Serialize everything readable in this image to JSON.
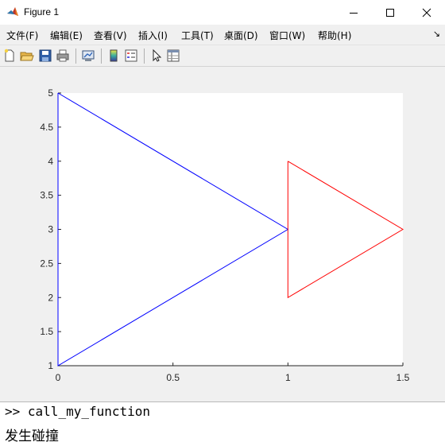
{
  "window": {
    "title": "Figure 1"
  },
  "menubar": {
    "items": [
      "文件(F)",
      "编辑(E)",
      "查看(V)",
      "插入(I)",
      "工具(T)",
      "桌面(D)",
      "窗口(W)",
      "帮助(H)"
    ]
  },
  "toolbar": {
    "icons": [
      "new-figure-icon",
      "open-file-icon",
      "save-icon",
      "print-icon",
      "link-plot-icon",
      "colorbar-icon",
      "legend-icon",
      "pointer-icon",
      "property-inspector-icon"
    ]
  },
  "chart_data": {
    "type": "line",
    "title": "",
    "xlabel": "",
    "ylabel": "",
    "xlim": [
      0,
      1.5
    ],
    "ylim": [
      1,
      5
    ],
    "xticks": [
      "0",
      "0.5",
      "1",
      "1.5"
    ],
    "yticks": [
      "1",
      "1.5",
      "2",
      "2.5",
      "3",
      "3.5",
      "4",
      "4.5",
      "5"
    ],
    "grid": false,
    "series": [
      {
        "color": "#0000ff",
        "x": [
          0,
          1,
          0,
          0
        ],
        "y": [
          5,
          3,
          1,
          5
        ]
      },
      {
        "color": "#ff0000",
        "x": [
          1,
          1.5,
          1,
          1
        ],
        "y": [
          4,
          3,
          2,
          4
        ]
      }
    ]
  },
  "console": {
    "prompt": ">>",
    "command": "call_my_function",
    "output": "发生碰撞"
  }
}
